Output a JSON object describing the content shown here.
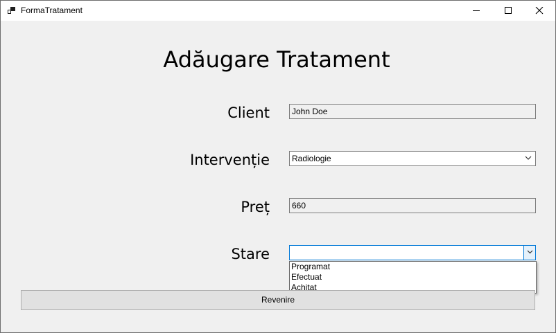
{
  "window": {
    "title": "FormaTratament"
  },
  "form": {
    "heading": "Adăugare Tratament",
    "client_label": "Client",
    "client_value": "John Doe",
    "interventie_label": "Intervenție",
    "interventie_value": "Radiologie",
    "pret_label": "Preț",
    "pret_value": "660",
    "stare_label": "Stare",
    "stare_value": "",
    "stare_options": [
      "Programat",
      "Efectuat",
      "Achitat"
    ],
    "revenire_label": "Revenire"
  }
}
